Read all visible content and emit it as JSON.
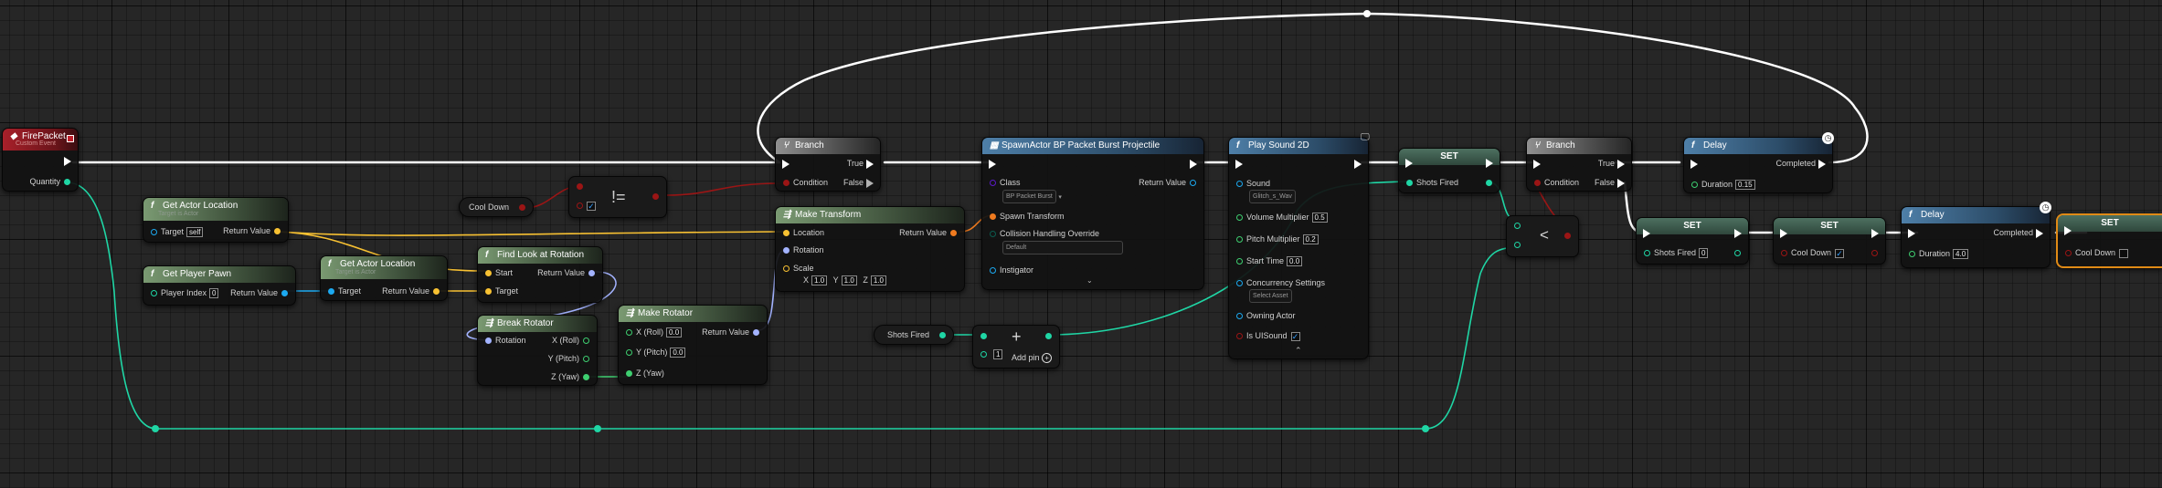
{
  "nodes": {
    "firepacket": {
      "title": "FirePacket",
      "subtitle": "Custom Event",
      "pin_quantity": "Quantity"
    },
    "get_actor_location_1": {
      "title": "Get Actor Location",
      "subtitle": "Target is Actor",
      "pin_target": "Target",
      "target_value": "self",
      "pin_return": "Return Value"
    },
    "get_player_pawn": {
      "title": "Get Player Pawn",
      "pin_player_index": "Player Index",
      "player_index_value": "0",
      "pin_return": "Return Value"
    },
    "get_actor_location_2": {
      "title": "Get Actor Location",
      "subtitle": "Target is Actor",
      "pin_target": "Target",
      "pin_return": "Return Value"
    },
    "cool_down_get": {
      "label": "Cool Down"
    },
    "not_equal": {
      "symbol": "!="
    },
    "find_look_at": {
      "title": "Find Look at Rotation",
      "pin_start": "Start",
      "pin_target": "Target",
      "pin_return": "Return Value"
    },
    "break_rotator": {
      "title": "Break Rotator",
      "pin_rotation": "Rotation",
      "pin_x": "X (Roll)",
      "pin_y": "Y (Pitch)",
      "pin_z": "Z (Yaw)"
    },
    "make_rotator": {
      "title": "Make Rotator",
      "pin_x": "X (Roll)",
      "x_value": "0.0",
      "pin_y": "Y (Pitch)",
      "y_value": "0.0",
      "pin_z": "Z (Yaw)",
      "pin_return": "Return Value"
    },
    "branch_1": {
      "title": "Branch",
      "pin_condition": "Condition",
      "pin_true": "True",
      "pin_false": "False"
    },
    "make_transform": {
      "title": "Make Transform",
      "pin_location": "Location",
      "pin_rotation": "Rotation",
      "pin_scale": "Scale",
      "scale_x": "1.0",
      "scale_y": "1.0",
      "scale_z": "1.0",
      "axis_x": "X",
      "axis_y": "Y",
      "axis_z": "Z",
      "pin_return": "Return Value"
    },
    "shots_fired_get": {
      "label": "Shots Fired"
    },
    "add": {
      "symbol": "+",
      "value": "1",
      "add_pin": "Add pin"
    },
    "spawn_actor": {
      "title": "SpawnActor BP Packet Burst Projectile",
      "pin_class": "Class",
      "class_value": "BP Packet Burst",
      "pin_return": "Return Value",
      "pin_spawn_transform": "Spawn Transform",
      "pin_collision": "Collision Handling Override",
      "collision_value": "Default",
      "pin_instigator": "Instigator"
    },
    "play_sound": {
      "title": "Play Sound 2D",
      "pin_sound": "Sound",
      "sound_value": "Glitch_s_Wav",
      "pin_volume": "Volume Multiplier",
      "volume_value": "0.5",
      "pin_pitch": "Pitch Multiplier",
      "pitch_value": "0.2",
      "pin_start": "Start Time",
      "start_value": "0.0",
      "pin_concurrency": "Concurrency Settings",
      "concurrency_value": "Select Asset",
      "pin_owning": "Owning Actor",
      "pin_ui": "Is UISound"
    },
    "set_shots_fired_1": {
      "title": "SET",
      "pin_shots_fired": "Shots Fired"
    },
    "less_than": {
      "symbol": "<"
    },
    "branch_2": {
      "title": "Branch",
      "pin_condition": "Condition",
      "pin_true": "True",
      "pin_false": "False"
    },
    "delay_1": {
      "title": "Delay",
      "pin_duration": "Duration",
      "duration_value": "0.15",
      "pin_completed": "Completed"
    },
    "set_shots_fired_2": {
      "title": "SET",
      "pin_shots_fired": "Shots Fired",
      "value": "0"
    },
    "set_cool_down_1": {
      "title": "SET",
      "pin_cool_down": "Cool Down"
    },
    "delay_2": {
      "title": "Delay",
      "pin_duration": "Duration",
      "duration_value": "4.0",
      "pin_completed": "Completed"
    },
    "set_cool_down_2": {
      "title": "SET",
      "pin_cool_down": "Cool Down"
    }
  },
  "colors": {
    "exec": "#ffffff",
    "bool": "#9b1515",
    "vector": "#f8c132",
    "rotator": "#a3b3ff",
    "float": "#3ecf70",
    "integer": "#1fd6a5",
    "object": "#1ca9f0",
    "class": "#5b1ac9",
    "transform": "#ee7a1f",
    "event_header": "#a8202a",
    "function_header": "#5e7f58",
    "call_header": "#4e7fa8",
    "set_header": "#3e5e50",
    "selection": "#e08a16"
  },
  "icons": [
    "function-icon",
    "branch-icon",
    "macro-icon",
    "clock-icon",
    "pin-icon",
    "monitor-icon"
  ]
}
